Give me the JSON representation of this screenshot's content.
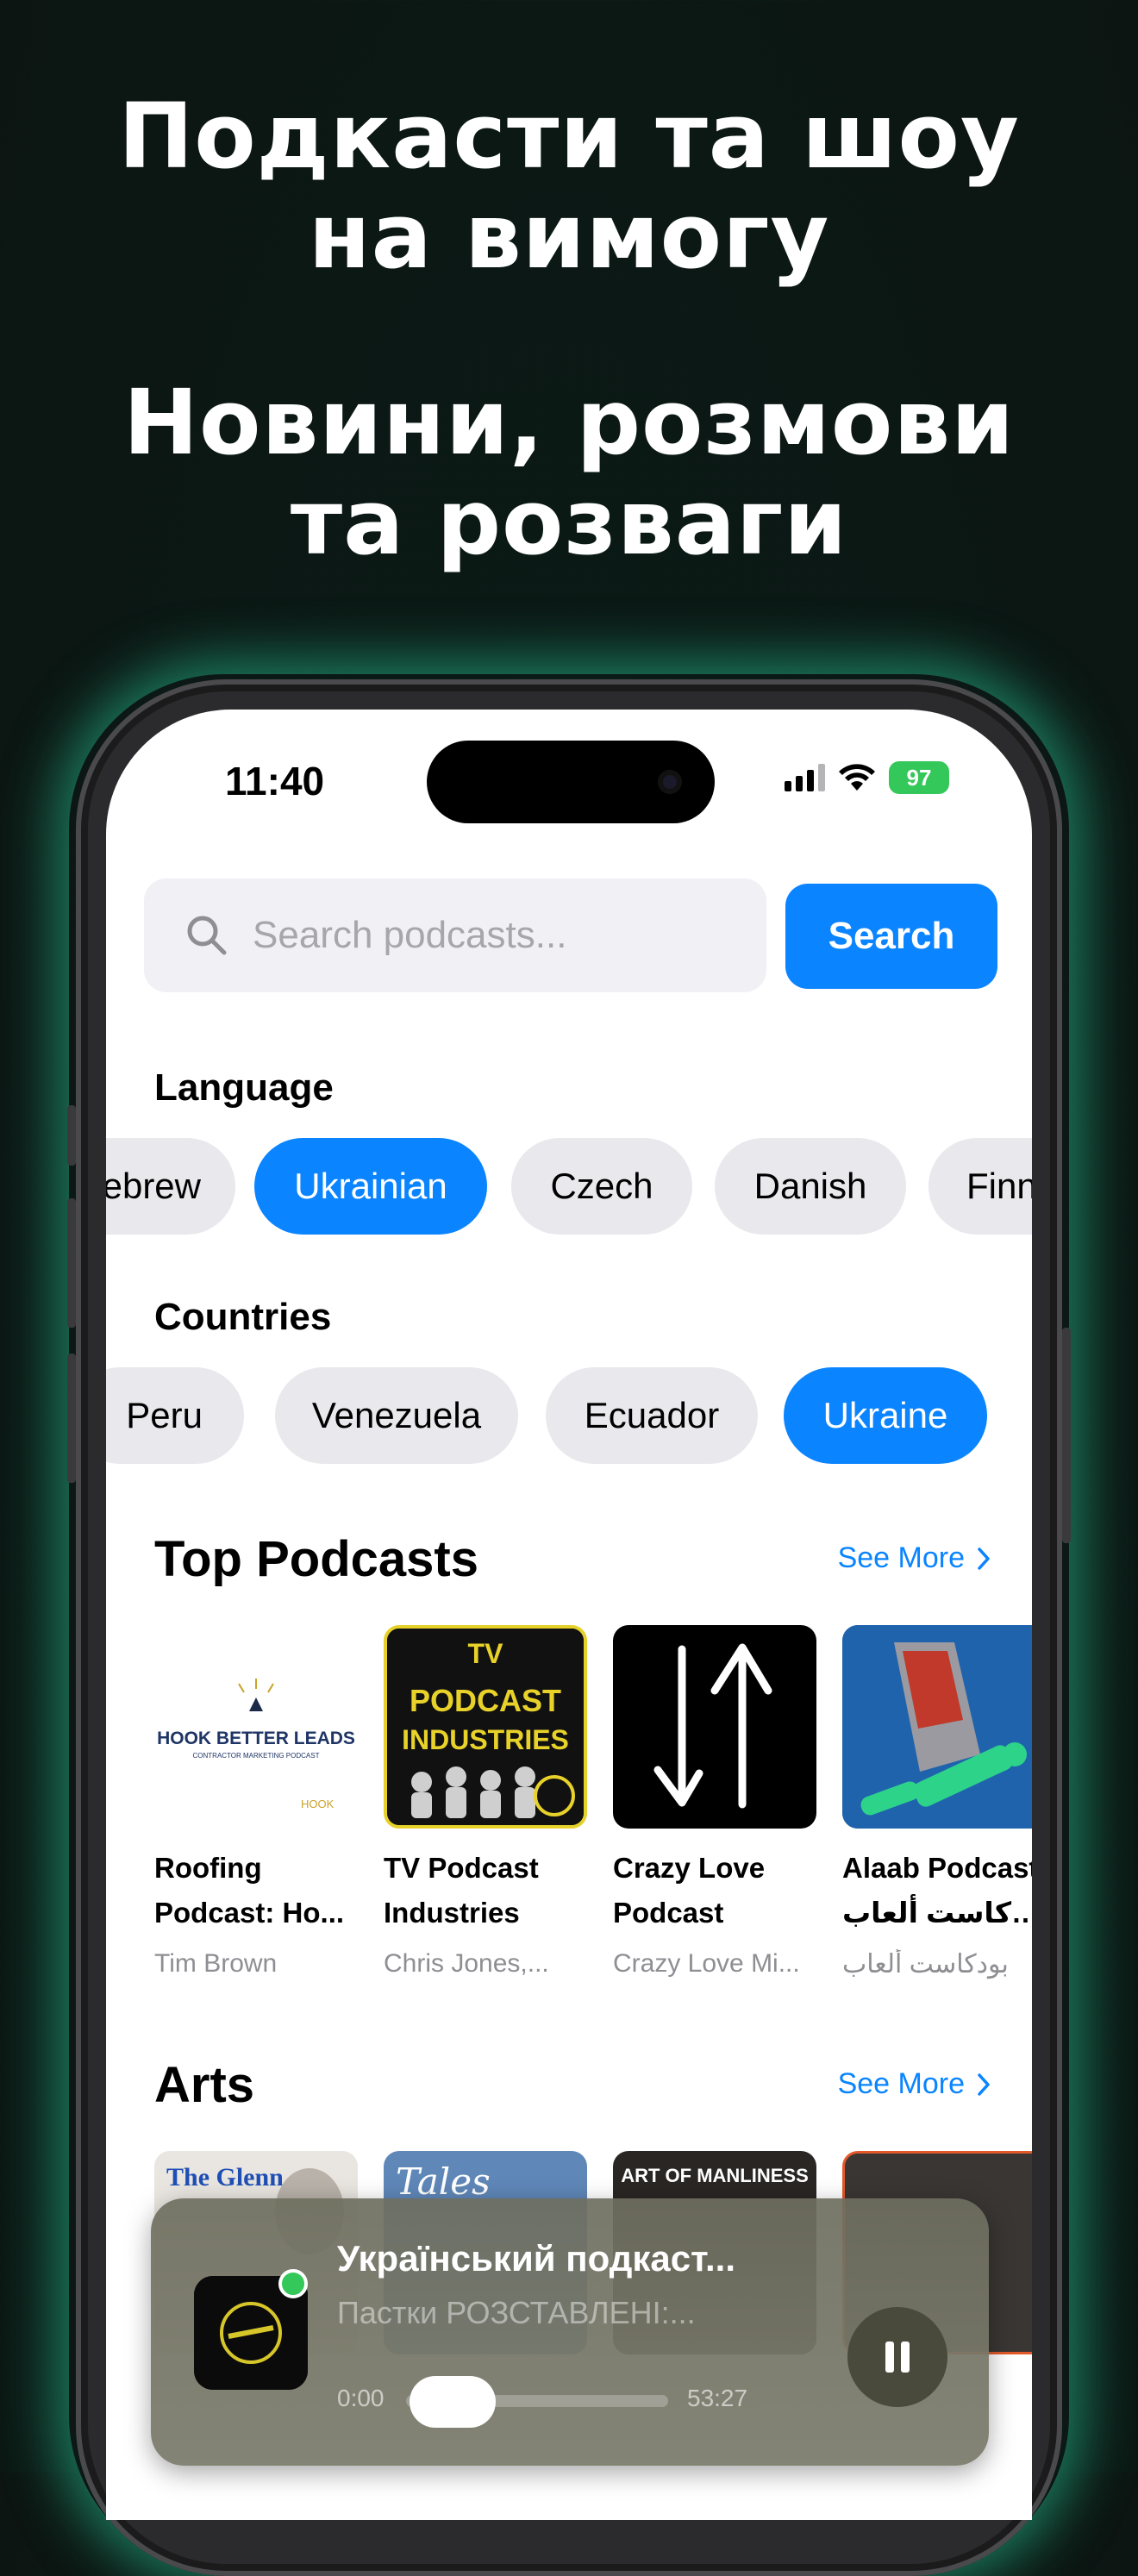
{
  "promo": {
    "line1": "Подкасти та шоу на вимогу",
    "line2": "Новини, розмови та розваги"
  },
  "status_bar": {
    "time": "11:40",
    "battery": "97"
  },
  "search": {
    "placeholder": "Search podcasts...",
    "button_label": "Search"
  },
  "language": {
    "label": "Language",
    "chips": [
      {
        "label": "Hebrew",
        "active": false
      },
      {
        "label": "Ukrainian",
        "active": true
      },
      {
        "label": "Czech",
        "active": false
      },
      {
        "label": "Danish",
        "active": false
      },
      {
        "label": "Finnish",
        "active": false
      }
    ]
  },
  "countries": {
    "label": "Countries",
    "chips": [
      {
        "label": "Peru",
        "active": false
      },
      {
        "label": "Venezuela",
        "active": false
      },
      {
        "label": "Ecuador",
        "active": false
      },
      {
        "label": "Ukraine",
        "active": true
      }
    ]
  },
  "top_podcasts": {
    "title": "Top Podcasts",
    "see_more": "See More",
    "items": [
      {
        "title_line1": "Roofing",
        "title_line2": "Podcast: Ho...",
        "author": "Tim Brown",
        "cover_text": "HOOK BETTER LEADS",
        "cover_sub": "CONTRACTOR MARKETING PODCAST",
        "cover_brand": "HOOK"
      },
      {
        "title_line1": "TV Podcast",
        "title_line2": "Industries",
        "author": "Chris Jones,...",
        "cover_text": "TV PODCAST INDUSTRIES"
      },
      {
        "title_line1": "Crazy Love",
        "title_line2": "Podcast",
        "author": "Crazy Love Mi..."
      },
      {
        "title_line1": "Alaab Podcast",
        "title_line2": "بودكاست ألعاب",
        "author": "بودكاست ألعاب"
      }
    ]
  },
  "arts": {
    "title": "Arts",
    "see_more": "See More",
    "items": [
      {
        "cover_text": "The Glenn"
      },
      {
        "cover_text": "Tales"
      },
      {
        "cover_text": "ART OF MANLINESS"
      },
      {
        "cover_text": ""
      }
    ]
  },
  "player": {
    "title": "Український подкаст...",
    "subtitle": "Пастки РОЗСТАВЛЕНІ:...",
    "time_start": "0:00",
    "time_end": "53:27",
    "progress": 0.0
  },
  "colors": {
    "accent": "#0a84ff",
    "live": "#34c759",
    "battery": "#34c759"
  }
}
